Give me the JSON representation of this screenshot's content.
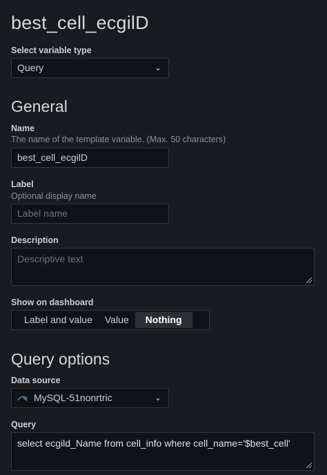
{
  "page": {
    "title": "best_cell_ecgilD"
  },
  "variable_type": {
    "label": "Select variable type",
    "value": "Query"
  },
  "general": {
    "heading": "General",
    "name": {
      "label": "Name",
      "description": "The name of the template variable. (Max. 50 characters)",
      "value": "best_cell_ecgilD"
    },
    "label_field": {
      "label": "Label",
      "description": "Optional display name",
      "placeholder": "Label name"
    },
    "description_field": {
      "label": "Description",
      "placeholder": "Descriptive text"
    },
    "show_on_dashboard": {
      "label": "Show on dashboard",
      "options": [
        "Label and value",
        "Value",
        "Nothing"
      ],
      "selected": "Nothing"
    }
  },
  "query_options": {
    "heading": "Query options",
    "data_source": {
      "label": "Data source",
      "value": "MySQL-51nonrtric",
      "icon": "mysql-icon"
    },
    "query": {
      "label": "Query",
      "value": "select ecgild_Name from cell_info where cell_name='$best_cell'"
    }
  },
  "colors": {
    "background": "#181b1f",
    "input_bg": "#111217",
    "border": "#34373d",
    "active_segment": "#2c3035"
  }
}
